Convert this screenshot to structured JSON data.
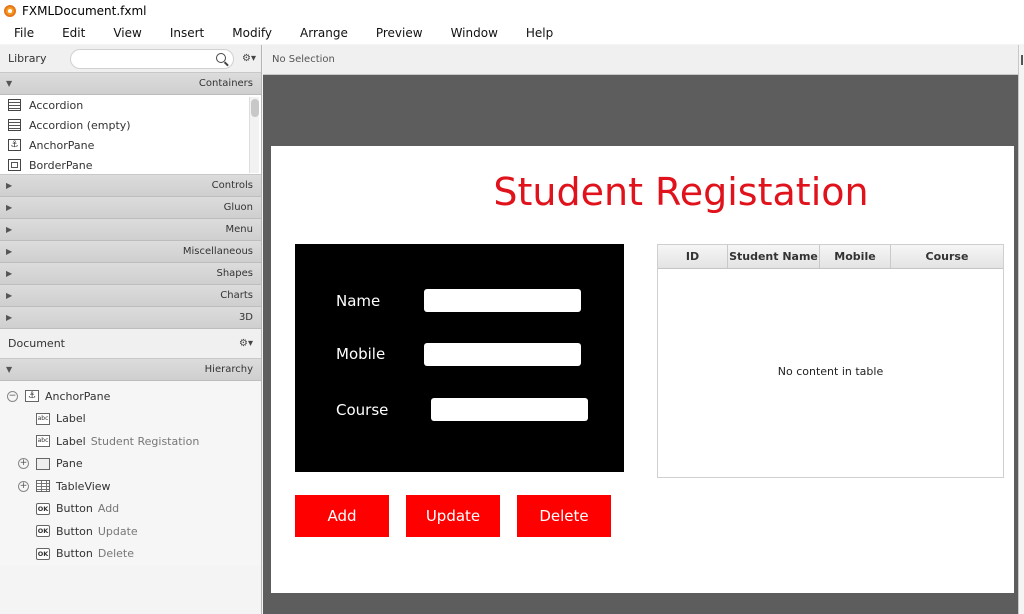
{
  "window": {
    "title": "FXMLDocument.fxml"
  },
  "menubar": [
    "File",
    "Edit",
    "View",
    "Insert",
    "Modify",
    "Arrange",
    "Preview",
    "Window",
    "Help"
  ],
  "library": {
    "label": "Library",
    "search_placeholder": "",
    "sections": {
      "containers": "Containers",
      "collapsed": [
        "Controls",
        "Gluon",
        "Menu",
        "Miscellaneous",
        "Shapes",
        "Charts",
        "3D"
      ]
    },
    "container_items": [
      "Accordion",
      "Accordion  (empty)",
      "AnchorPane",
      "BorderPane"
    ]
  },
  "document": {
    "label": "Document",
    "hierarchy_label": "Hierarchy",
    "tree": [
      {
        "type": "AnchorPane",
        "sub": ""
      },
      {
        "type": "Label",
        "sub": ""
      },
      {
        "type": "Label",
        "sub": "Student Registation"
      },
      {
        "type": "Pane",
        "sub": ""
      },
      {
        "type": "TableView",
        "sub": ""
      },
      {
        "type": "Button",
        "sub": "Add"
      },
      {
        "type": "Button",
        "sub": "Update"
      },
      {
        "type": "Button",
        "sub": "Delete"
      }
    ]
  },
  "selection": "No Selection",
  "form": {
    "heading": "Student Registation",
    "fields": {
      "name": "Name",
      "mobile": "Mobile",
      "course": "Course"
    },
    "buttons": {
      "add": "Add",
      "update": "Update",
      "delete": "Delete"
    }
  },
  "table": {
    "columns": [
      "ID",
      "Student Name",
      "Mobile",
      "Course"
    ],
    "empty_message": "No content in table"
  },
  "colors": {
    "accent_red": "#e0121b",
    "button_red": "#fe0000",
    "pane_black": "#000000"
  }
}
